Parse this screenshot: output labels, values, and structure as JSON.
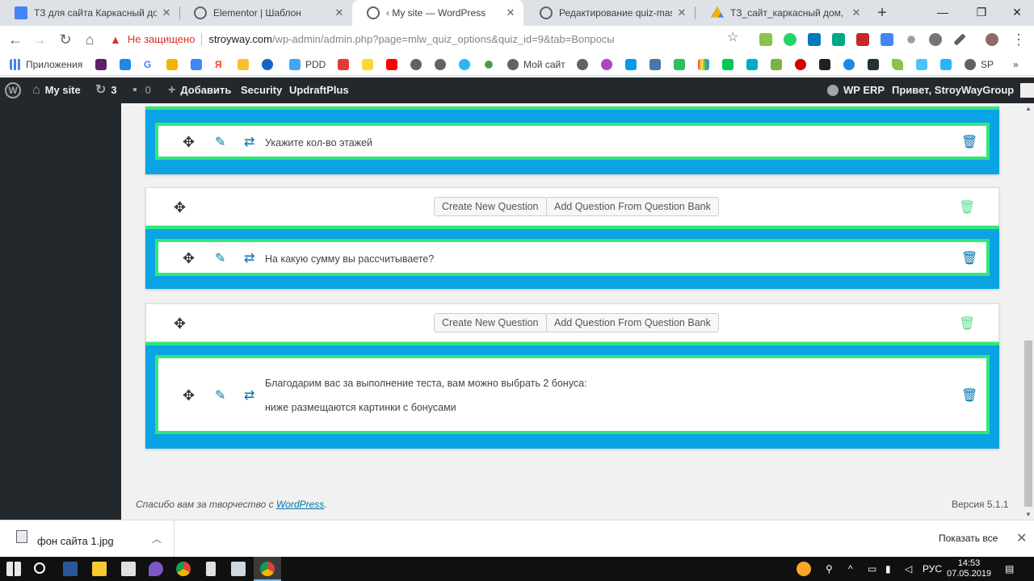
{
  "tabs": [
    {
      "title": "ТЗ для сайта Каркасный дом,",
      "active": false
    },
    {
      "title": "Elementor | Шаблон",
      "active": false
    },
    {
      "title": "‹ My site — WordPress",
      "active": true
    },
    {
      "title": "Редактирование quiz-master-",
      "active": false
    },
    {
      "title": "ТЗ_сайт_каркасный дом, котт",
      "active": false
    }
  ],
  "window_controls": {
    "min": "—",
    "max": "❐",
    "close": "✕"
  },
  "address": {
    "security_label": "Не защищено",
    "host": "stroyway.com",
    "path": "/wp-admin/admin.php?page=mlw_quiz_options&quiz_id=9&tab=Вопросы"
  },
  "bookmarks": {
    "apps": "Приложения",
    "pdd": "PDD",
    "my_site": "Мой сайт",
    "sp": "SP"
  },
  "admin_bar": {
    "site_name": "My site",
    "updates_count": "3",
    "comments_count": "0",
    "add_new": "Добавить",
    "security": "Security",
    "updraft": "UpdraftPlus",
    "wp_erp": "WP ERP",
    "greeting": "Привет, StroyWayGroup"
  },
  "pages": [
    {
      "create_label": "Create New Question",
      "bank_label": "Add Question From Question Bank"
    },
    {
      "create_label": "Create New Question",
      "bank_label": "Add Question From Question Bank"
    }
  ],
  "questions": [
    {
      "text": "Укажите кол-во этажей"
    },
    {
      "text": "На какую сумму вы рассчитываете?"
    },
    {
      "line1": "Благодарим вас за выполнение теста, вам можно выбрать 2 бонуса:",
      "line2": "ниже размещаются картинки с бонусами"
    }
  ],
  "footer": {
    "thanks_prefix": "Спасибо вам за творчество с ",
    "wordpress_link": "WordPress",
    "thanks_suffix": ".",
    "version": "Версия 5.1.1"
  },
  "downloads": {
    "file_name": "фон сайта 1.jpg",
    "show_all": "Показать все"
  },
  "taskbar": {
    "language": "РУС",
    "time": "14:53",
    "date": "07.05.2019"
  },
  "colors": {
    "block_blue": "#0aa3e3",
    "block_green": "#2ee87a",
    "wp_dark": "#23282d",
    "wp_link": "#0073aa"
  }
}
